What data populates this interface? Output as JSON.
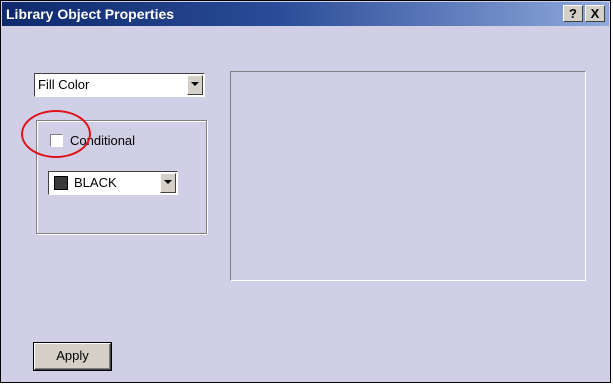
{
  "window": {
    "title": "Library Object Properties",
    "help_label": "?",
    "close_label": "X"
  },
  "property_select": {
    "value": "Fill Color"
  },
  "conditional": {
    "label": "Conditional",
    "checked": false
  },
  "color_select": {
    "value": "BLACK",
    "swatch_color": "#3a3a3a"
  },
  "apply_button": {
    "label": "Apply"
  },
  "colors": {
    "dialog_bg": "#d1cfe6",
    "titlebar_start": "#0e2a6c",
    "titlebar_end": "#8fa9dd",
    "annotation_ring": "#e0131b"
  }
}
